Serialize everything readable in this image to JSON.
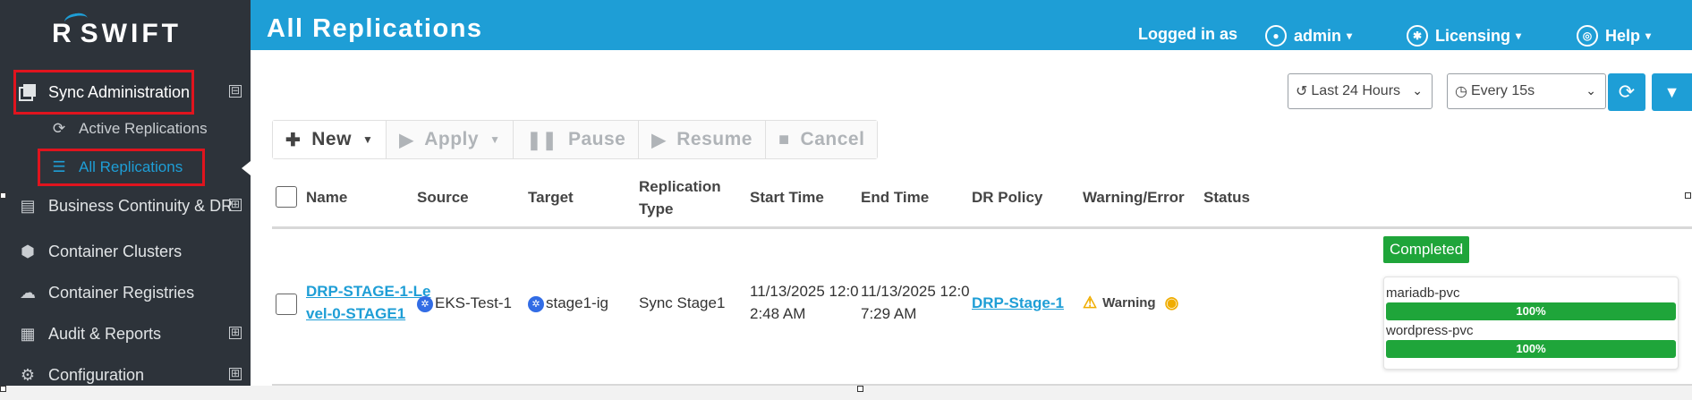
{
  "app": {
    "logo_text": "SWIFT",
    "logo_mark": "R"
  },
  "sidebar": {
    "items": [
      {
        "label": "Sync Administration",
        "icon": "copy-icon",
        "expander": "⊟"
      },
      {
        "label": "Business Continuity & DR",
        "icon": "scroll-icon",
        "expander": "⊞"
      },
      {
        "label": "Container Clusters",
        "icon": "cube-icon",
        "expander": ""
      },
      {
        "label": "Container Registries",
        "icon": "cloud-folder-icon",
        "expander": ""
      },
      {
        "label": "Audit & Reports",
        "icon": "table-icon",
        "expander": "⊞"
      },
      {
        "label": "Configuration",
        "icon": "gears-icon",
        "expander": "⊞"
      }
    ],
    "sub_items": [
      {
        "label": "Active Replications",
        "icon": "sync-icon"
      },
      {
        "label": "All Replications",
        "icon": "list-icon"
      }
    ]
  },
  "header": {
    "title": "All Replications",
    "logged_in_as": "Logged in as",
    "user": "admin",
    "licensing": "Licensing",
    "help": "Help"
  },
  "filters": {
    "time_range": "Last 24 Hours",
    "refresh_interval": "Every 15s"
  },
  "toolbar": {
    "new": "New",
    "apply": "Apply",
    "pause": "Pause",
    "resume": "Resume",
    "cancel": "Cancel"
  },
  "table": {
    "headers": {
      "name": "Name",
      "source": "Source",
      "target": "Target",
      "replication_type_1": "Replication",
      "replication_type_2": "Type",
      "start_time": "Start Time",
      "end_time": "End Time",
      "dr_policy": "DR Policy",
      "warning_error": "Warning/Error",
      "status": "Status"
    },
    "rows": [
      {
        "name_1": "DRP-STAGE-1-Le",
        "name_2": "vel-0-STAGE1",
        "source": "EKS-Test-1",
        "target": "stage1-ig",
        "replication_type": "Sync Stage1",
        "start_time_1": "11/13/2025 12:0",
        "start_time_2": "2:48 AM",
        "end_time_1": "11/13/2025 12:0",
        "end_time_2": "7:29 AM",
        "dr_policy": "DRP-Stage-1",
        "warning": "Warning",
        "status": "Completed",
        "pvcs": [
          {
            "name": "mariadb-pvc",
            "progress": "100%"
          },
          {
            "name": "wordpress-pvc",
            "progress": "100%"
          }
        ]
      }
    ]
  },
  "colors": {
    "header_bg": "#1e9ed6",
    "sidebar_bg": "#2d333a",
    "accent": "#1e9ed6",
    "success": "#1fa53a",
    "highlight_box": "#e0141e",
    "warning": "#f0ad00"
  }
}
